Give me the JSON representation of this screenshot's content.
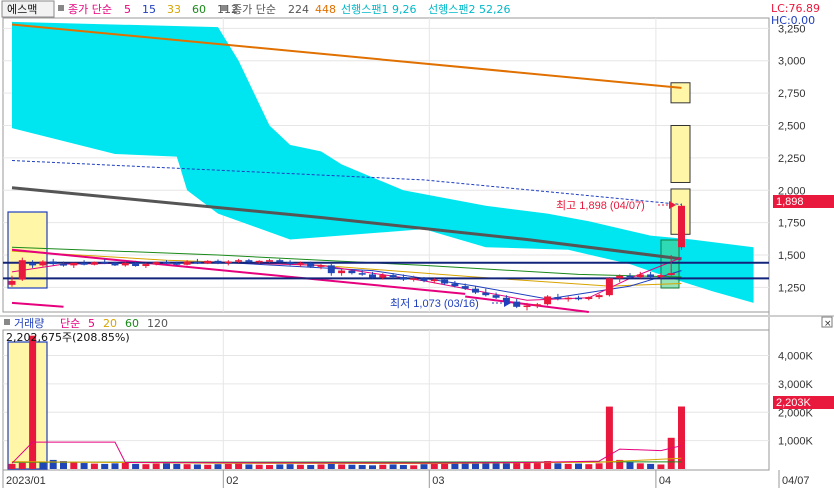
{
  "header": {
    "stock_name": "에스맥",
    "ma_label": "종가 단순",
    "ma_periods": [
      {
        "text": "5",
        "color": "#e6007e"
      },
      {
        "text": "15",
        "color": "#1f3fbf"
      },
      {
        "text": "33",
        "color": "#d8a400"
      },
      {
        "text": "60",
        "color": "#1a8a1a"
      },
      {
        "text": "112",
        "color": "#555555"
      }
    ],
    "ma2_label": "종가 단순",
    "ma2_periods": [
      {
        "text": "224",
        "color": "#555555"
      },
      {
        "text": "448",
        "color": "#e07000"
      }
    ],
    "span1": "선행스팬1 9,26",
    "span2": "선행스팬2 52,26",
    "lc": "LC:76.89",
    "hc": "HC:0.00"
  },
  "volume_header": {
    "label": "거래량",
    "ma_label": "단순",
    "periods": [
      {
        "text": "5",
        "color": "#e6007e"
      },
      {
        "text": "20",
        "color": "#d8a400"
      },
      {
        "text": "60",
        "color": "#1a8a1a"
      },
      {
        "text": "120",
        "color": "#555555"
      }
    ],
    "last_volume": "2,202,675주(208.85%)"
  },
  "annotations": {
    "high": "최고 1,898 (04/07)",
    "low": "최저 1,073 (03/16)",
    "price_badge": "1,898",
    "volume_badge": "2,203K"
  },
  "colors": {
    "up": "#e8193c",
    "down": "#1f46b4",
    "cloud": "#00e6f0",
    "ma448": "#e07000",
    "ma224": "#555555",
    "badge": "#e8193c",
    "highlight_box": "#fff6a8"
  },
  "chart_data": [
    {
      "type": "candlestick",
      "panel": "price",
      "ylim": [
        1060,
        3330
      ],
      "y_ticks": [
        "3,250",
        "3,000",
        "2,750",
        "2,500",
        "2,250",
        "2,000",
        "1,750",
        "1,500",
        "1,250"
      ],
      "y_tick_values": [
        3250,
        3000,
        2750,
        2500,
        2250,
        2000,
        1750,
        1500,
        1250
      ],
      "x_ticks": [
        "2023/01",
        "02",
        "03",
        "04",
        "04/07"
      ],
      "x_tick_index": [
        0,
        21,
        41,
        63,
        65
      ],
      "bar_count": 66,
      "candles": [
        {
          "o": 1270,
          "h": 1340,
          "l": 1255,
          "c": 1300
        },
        {
          "o": 1310,
          "h": 1480,
          "l": 1300,
          "c": 1460
        },
        {
          "o": 1440,
          "h": 1460,
          "l": 1400,
          "c": 1420
        },
        {
          "o": 1420,
          "h": 1460,
          "l": 1410,
          "c": 1450
        },
        {
          "o": 1450,
          "h": 1470,
          "l": 1420,
          "c": 1430
        },
        {
          "o": 1430,
          "h": 1450,
          "l": 1410,
          "c": 1420
        },
        {
          "o": 1420,
          "h": 1440,
          "l": 1400,
          "c": 1440
        },
        {
          "o": 1440,
          "h": 1460,
          "l": 1420,
          "c": 1425
        },
        {
          "o": 1425,
          "h": 1450,
          "l": 1420,
          "c": 1445
        },
        {
          "o": 1445,
          "h": 1470,
          "l": 1430,
          "c": 1440
        },
        {
          "o": 1440,
          "h": 1450,
          "l": 1415,
          "c": 1420
        },
        {
          "o": 1420,
          "h": 1450,
          "l": 1410,
          "c": 1440
        },
        {
          "o": 1440,
          "h": 1455,
          "l": 1410,
          "c": 1415
        },
        {
          "o": 1415,
          "h": 1440,
          "l": 1400,
          "c": 1430
        },
        {
          "o": 1430,
          "h": 1450,
          "l": 1420,
          "c": 1445
        },
        {
          "o": 1445,
          "h": 1460,
          "l": 1430,
          "c": 1440
        },
        {
          "o": 1440,
          "h": 1450,
          "l": 1420,
          "c": 1425
        },
        {
          "o": 1425,
          "h": 1460,
          "l": 1420,
          "c": 1450
        },
        {
          "o": 1450,
          "h": 1470,
          "l": 1430,
          "c": 1435
        },
        {
          "o": 1435,
          "h": 1460,
          "l": 1430,
          "c": 1455
        },
        {
          "o": 1455,
          "h": 1465,
          "l": 1430,
          "c": 1440
        },
        {
          "o": 1440,
          "h": 1460,
          "l": 1420,
          "c": 1450
        },
        {
          "o": 1450,
          "h": 1470,
          "l": 1440,
          "c": 1460
        },
        {
          "o": 1460,
          "h": 1470,
          "l": 1440,
          "c": 1445
        },
        {
          "o": 1445,
          "h": 1460,
          "l": 1430,
          "c": 1455
        },
        {
          "o": 1455,
          "h": 1470,
          "l": 1440,
          "c": 1460
        },
        {
          "o": 1460,
          "h": 1470,
          "l": 1440,
          "c": 1445
        },
        {
          "o": 1445,
          "h": 1460,
          "l": 1420,
          "c": 1430
        },
        {
          "o": 1430,
          "h": 1450,
          "l": 1410,
          "c": 1440
        },
        {
          "o": 1440,
          "h": 1450,
          "l": 1400,
          "c": 1410
        },
        {
          "o": 1410,
          "h": 1430,
          "l": 1390,
          "c": 1420
        },
        {
          "o": 1420,
          "h": 1440,
          "l": 1340,
          "c": 1360
        },
        {
          "o": 1360,
          "h": 1400,
          "l": 1340,
          "c": 1380
        },
        {
          "o": 1380,
          "h": 1390,
          "l": 1350,
          "c": 1360
        },
        {
          "o": 1360,
          "h": 1380,
          "l": 1340,
          "c": 1350
        },
        {
          "o": 1350,
          "h": 1370,
          "l": 1320,
          "c": 1325
        },
        {
          "o": 1325,
          "h": 1360,
          "l": 1310,
          "c": 1345
        },
        {
          "o": 1345,
          "h": 1360,
          "l": 1320,
          "c": 1330
        },
        {
          "o": 1330,
          "h": 1350,
          "l": 1300,
          "c": 1310
        },
        {
          "o": 1310,
          "h": 1340,
          "l": 1295,
          "c": 1320
        },
        {
          "o": 1320,
          "h": 1330,
          "l": 1290,
          "c": 1300
        },
        {
          "o": 1300,
          "h": 1320,
          "l": 1280,
          "c": 1310
        },
        {
          "o": 1310,
          "h": 1320,
          "l": 1270,
          "c": 1280
        },
        {
          "o": 1280,
          "h": 1300,
          "l": 1250,
          "c": 1260
        },
        {
          "o": 1260,
          "h": 1280,
          "l": 1230,
          "c": 1240
        },
        {
          "o": 1240,
          "h": 1260,
          "l": 1200,
          "c": 1210
        },
        {
          "o": 1210,
          "h": 1240,
          "l": 1180,
          "c": 1190
        },
        {
          "o": 1190,
          "h": 1210,
          "l": 1160,
          "c": 1170
        },
        {
          "o": 1170,
          "h": 1190,
          "l": 1130,
          "c": 1140
        },
        {
          "o": 1140,
          "h": 1160,
          "l": 1090,
          "c": 1100
        },
        {
          "o": 1100,
          "h": 1130,
          "l": 1073,
          "c": 1110
        },
        {
          "o": 1110,
          "h": 1130,
          "l": 1090,
          "c": 1120
        },
        {
          "o": 1120,
          "h": 1190,
          "l": 1110,
          "c": 1180
        },
        {
          "o": 1175,
          "h": 1200,
          "l": 1150,
          "c": 1160
        },
        {
          "o": 1160,
          "h": 1180,
          "l": 1140,
          "c": 1170
        },
        {
          "o": 1170,
          "h": 1185,
          "l": 1150,
          "c": 1160
        },
        {
          "o": 1160,
          "h": 1180,
          "l": 1150,
          "c": 1175
        },
        {
          "o": 1175,
          "h": 1200,
          "l": 1160,
          "c": 1190
        },
        {
          "o": 1190,
          "h": 1330,
          "l": 1180,
          "c": 1320
        },
        {
          "o": 1320,
          "h": 1350,
          "l": 1290,
          "c": 1340
        },
        {
          "o": 1340,
          "h": 1360,
          "l": 1320,
          "c": 1330
        },
        {
          "o": 1330,
          "h": 1370,
          "l": 1320,
          "c": 1350
        },
        {
          "o": 1350,
          "h": 1370,
          "l": 1320,
          "c": 1330
        },
        {
          "o": 1330,
          "h": 1360,
          "l": 1320,
          "c": 1345
        },
        {
          "o": 1345,
          "h": 1500,
          "l": 1340,
          "c": 1360
        },
        {
          "o": 1560,
          "h": 1898,
          "l": 1540,
          "c": 1880
        }
      ],
      "ma448": [
        [
          0,
          3280
        ],
        [
          65,
          2790
        ]
      ],
      "ma224": [
        [
          0,
          2020
        ],
        [
          30,
          1790
        ],
        [
          50,
          1620
        ],
        [
          65,
          1470
        ]
      ],
      "ma_dashed": [
        [
          0,
          2230
        ],
        [
          40,
          2080
        ],
        [
          65,
          1890
        ]
      ],
      "ma5": [
        [
          0,
          1370
        ],
        [
          5,
          1430
        ],
        [
          20,
          1445
        ],
        [
          30,
          1420
        ],
        [
          40,
          1300
        ],
        [
          50,
          1150
        ],
        [
          56,
          1170
        ],
        [
          60,
          1320
        ],
        [
          65,
          1480
        ]
      ],
      "ma15": [
        [
          0,
          1440
        ],
        [
          20,
          1445
        ],
        [
          35,
          1380
        ],
        [
          45,
          1260
        ],
        [
          52,
          1160
        ],
        [
          60,
          1260
        ],
        [
          65,
          1380
        ]
      ],
      "ma33": [
        [
          0,
          1530
        ],
        [
          15,
          1460
        ],
        [
          30,
          1420
        ],
        [
          45,
          1330
        ],
        [
          58,
          1260
        ],
        [
          65,
          1280
        ]
      ],
      "ma60": [
        [
          0,
          1560
        ],
        [
          20,
          1500
        ],
        [
          40,
          1420
        ],
        [
          55,
          1350
        ],
        [
          65,
          1330
        ]
      ],
      "cloud_top": [
        [
          0,
          3300
        ],
        [
          20,
          3260
        ],
        [
          22,
          3000
        ],
        [
          25,
          2500
        ],
        [
          27,
          2350
        ],
        [
          30,
          2300
        ],
        [
          32,
          2200
        ],
        [
          38,
          2000
        ],
        [
          46,
          1880
        ],
        [
          52,
          1820
        ],
        [
          56,
          1760
        ],
        [
          62,
          1650
        ],
        [
          66,
          1620
        ],
        [
          72,
          1560
        ]
      ],
      "cloud_bottom": [
        [
          0,
          2480
        ],
        [
          10,
          2280
        ],
        [
          16,
          2260
        ],
        [
          17,
          2000
        ],
        [
          20,
          1820
        ],
        [
          27,
          1620
        ],
        [
          40,
          1700
        ],
        [
          46,
          1560
        ],
        [
          54,
          1540
        ],
        [
          60,
          1430
        ],
        [
          64,
          1320
        ],
        [
          68,
          1220
        ],
        [
          72,
          1130
        ]
      ],
      "trendlines": [
        {
          "color": "#e6007e",
          "points": [
            [
              0,
              1540
            ],
            [
              44,
              1200
            ]
          ]
        },
        {
          "color": "#e6007e",
          "points": [
            [
              0,
              1130
            ],
            [
              5,
              1100
            ]
          ]
        },
        {
          "color": "#e6007e",
          "points": [
            [
              44,
              1180
            ],
            [
              56,
              1060
            ]
          ]
        }
      ],
      "hlines": [
        1440,
        1320
      ],
      "projection_boxes": [
        [
          2675,
          2830
        ],
        [
          2060,
          2500
        ],
        [
          1660,
          2010
        ]
      ]
    },
    {
      "type": "bar",
      "panel": "volume",
      "ylim": [
        0,
        4900
      ],
      "unit": "K",
      "y_ticks": [
        "4,000K",
        "3,000K",
        "2,000K",
        "1,000K"
      ],
      "y_tick_values": [
        4000,
        3000,
        2000,
        1000
      ],
      "values": [
        180,
        220,
        4700,
        260,
        320,
        280,
        250,
        210,
        190,
        180,
        200,
        220,
        180,
        170,
        190,
        200,
        180,
        170,
        160,
        150,
        170,
        180,
        190,
        160,
        150,
        140,
        160,
        170,
        150,
        140,
        160,
        180,
        160,
        150,
        140,
        130,
        150,
        160,
        140,
        130,
        170,
        180,
        260,
        240,
        200,
        190,
        210,
        230,
        200,
        220,
        260,
        240,
        280,
        200,
        180,
        190,
        170,
        200,
        2200,
        320,
        250,
        200,
        180,
        160,
        1100,
        2203
      ],
      "up": [
        1,
        1,
        1,
        0,
        0,
        0,
        1,
        0,
        1,
        0,
        0,
        1,
        0,
        1,
        1,
        0,
        0,
        1,
        0,
        1,
        0,
        1,
        1,
        0,
        1,
        1,
        0,
        0,
        1,
        0,
        1,
        0,
        1,
        0,
        0,
        0,
        1,
        0,
        0,
        1,
        0,
        1,
        1,
        0,
        0,
        0,
        0,
        0,
        0,
        1,
        1,
        1,
        1,
        0,
        1,
        0,
        1,
        1,
        1,
        1,
        0,
        1,
        0,
        1,
        1,
        1
      ],
      "ma5": [
        [
          0,
          200
        ],
        [
          2,
          950
        ],
        [
          10,
          950
        ],
        [
          11,
          230
        ],
        [
          40,
          210
        ],
        [
          50,
          230
        ],
        [
          57,
          280
        ],
        [
          59,
          700
        ],
        [
          63,
          650
        ],
        [
          65,
          820
        ]
      ],
      "ma20": [
        [
          0,
          260
        ],
        [
          20,
          200
        ],
        [
          40,
          190
        ],
        [
          57,
          240
        ],
        [
          65,
          380
        ]
      ],
      "ma60": [
        [
          0,
          240
        ],
        [
          65,
          250
        ]
      ]
    }
  ]
}
